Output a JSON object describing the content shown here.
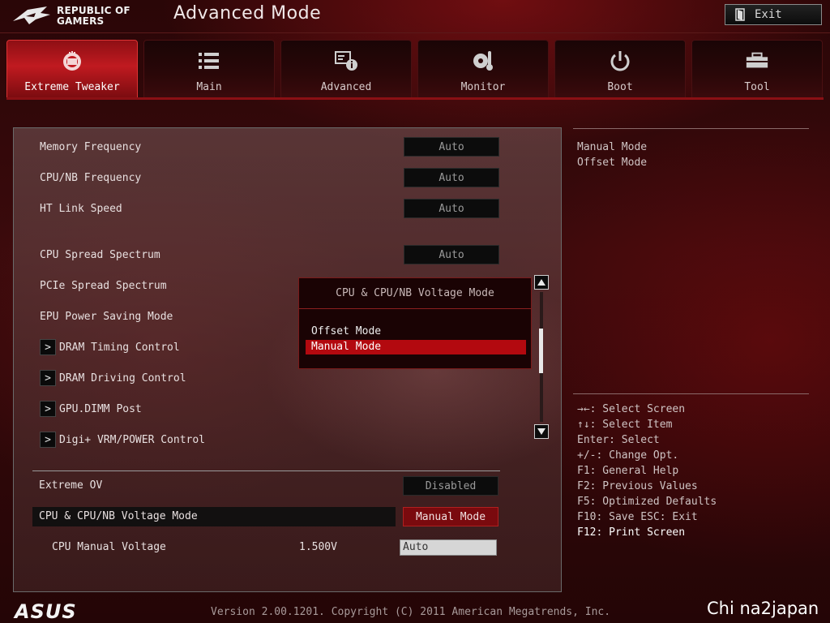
{
  "header": {
    "brand_line1": "REPUBLIC OF",
    "brand_line2": "GAMERS",
    "title": "Advanced Mode",
    "exit_label": "Exit"
  },
  "tabs": [
    {
      "label": "Extreme Tweaker",
      "icon": "tweaker-icon",
      "active": true
    },
    {
      "label": "Main",
      "icon": "list-icon",
      "active": false
    },
    {
      "label": "Advanced",
      "icon": "advanced-info-icon",
      "active": false
    },
    {
      "label": "Monitor",
      "icon": "thermometer-fan-icon",
      "active": false
    },
    {
      "label": "Boot",
      "icon": "power-icon",
      "active": false
    },
    {
      "label": "Tool",
      "icon": "toolbox-icon",
      "active": false
    }
  ],
  "settings": {
    "memory_frequency": {
      "label": "Memory Frequency",
      "value": "Auto"
    },
    "cpu_nb_frequency": {
      "label": "CPU/NB Frequency",
      "value": "Auto"
    },
    "ht_link_speed": {
      "label": "HT Link Speed",
      "value": "Auto"
    },
    "cpu_spread_spectrum": {
      "label": "CPU Spread Spectrum",
      "value": "Auto"
    },
    "pcie_spread_spectrum": {
      "label": "PCIe Spread Spectrum"
    },
    "epu_power_saving": {
      "label": "EPU Power Saving Mode"
    },
    "dram_timing": {
      "label": "DRAM Timing Control"
    },
    "dram_driving": {
      "label": "DRAM Driving Control"
    },
    "gpu_dimm_post": {
      "label": "GPU.DIMM Post"
    },
    "digi_vrm": {
      "label": "Digi+ VRM/POWER Control"
    },
    "extreme_ov": {
      "label": "Extreme OV",
      "value": "Disabled"
    },
    "voltage_mode": {
      "label": "CPU & CPU/NB Voltage Mode",
      "value": "Manual Mode"
    },
    "cpu_manual_voltage": {
      "label": "CPU Manual Voltage",
      "reading": "1.500V",
      "value": "Auto"
    }
  },
  "popup": {
    "title": "CPU & CPU/NB Voltage Mode",
    "options": [
      "Offset Mode",
      "Manual Mode"
    ],
    "selected_index": 1
  },
  "help": {
    "description": [
      "Manual Mode",
      "Offset Mode"
    ],
    "keys": [
      "→←: Select Screen",
      "↑↓: Select Item",
      "Enter: Select",
      "+/-: Change Opt.",
      "F1: General Help",
      "F2: Previous Values",
      "F5: Optimized Defaults",
      "F10: Save  ESC: Exit",
      "F12: Print Screen"
    ]
  },
  "footer": {
    "logo": "ASUS",
    "version": "Version 2.00.1201. Copyright (C) 2011 American Megatrends, Inc.",
    "watermark": "Chi na2japan"
  },
  "colors": {
    "accent_red": "#b3090f",
    "active_tab": "#c01a20",
    "value_box": "#0c0c0c"
  }
}
